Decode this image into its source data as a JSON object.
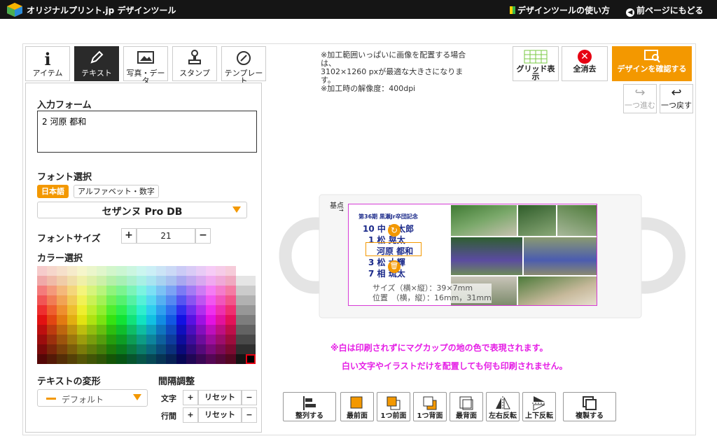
{
  "header": {
    "brand": "オリジナルプリント.jp",
    "subtitle": "デザインツール",
    "help_link": "デザインツールの使い方",
    "back_link": "前ページにもどる"
  },
  "tabs": [
    {
      "label": "アイテム"
    },
    {
      "label": "テキスト"
    },
    {
      "label": "写真・データ"
    },
    {
      "label": "スタンプ"
    },
    {
      "label": "テンプレート"
    }
  ],
  "form": {
    "input_label": "入力フォーム",
    "input_value": "2 河原 都和",
    "font_label": "フォント選択",
    "font_tab_ja": "日本語",
    "font_tab_alpha": "アルファベット・数字",
    "font_value": "セザンヌ Pro DB",
    "size_label": "フォントサイズ",
    "size_value": "21",
    "color_label": "カラー選択",
    "transform_label": "テキストの変形",
    "transform_value": "デフォルト",
    "spacing_label": "間隔調整",
    "char_label": "文字",
    "line_label": "行間",
    "reset_label": "リセット",
    "plus": "+",
    "minus": "−"
  },
  "notes": [
    "※加工範囲いっぱいに画像を配置する場合は、",
    "3102×1260 pxが最適な大きさになります。",
    "※加工時の解像度：400dpi"
  ],
  "toolbar": {
    "grid": "グリッド表示",
    "clear": "全消去",
    "confirm": "デザインを確認する",
    "redo": "一つ進む",
    "undo": "一つ戻す"
  },
  "canvas": {
    "origin_label": "基点",
    "design_title": "第36期 黒瀬Jr卒団記念",
    "players": [
      "10 中",
      "1 松",
      "河原 都和",
      "3 松",
      "7 相"
    ],
    "players_right": [
      "東太郎",
      "晃太",
      "",
      "大輝",
      "琉太"
    ],
    "size_info": "サイズ（横×縦）：39×7mm",
    "pos_info": "位置　（横，縦）：16mm，31mm"
  },
  "warnings": [
    "※白は印刷されずにマグカップの地の色で表現されます。",
    "白い文字やイラストだけを配置しても何も印刷されません。"
  ],
  "bottom": [
    {
      "label": "整列する"
    },
    {
      "label": "最前面"
    },
    {
      "label": "1つ前面"
    },
    {
      "label": "1つ背面"
    },
    {
      "label": "最背面"
    },
    {
      "label": "左右反転"
    },
    {
      "label": "上下反転"
    },
    {
      "label": "複製する"
    }
  ],
  "colors": {
    "accent": "#f39800",
    "topbar": "#151515",
    "warn": "#e51ee5",
    "active_tab": "#2a2a2a"
  }
}
